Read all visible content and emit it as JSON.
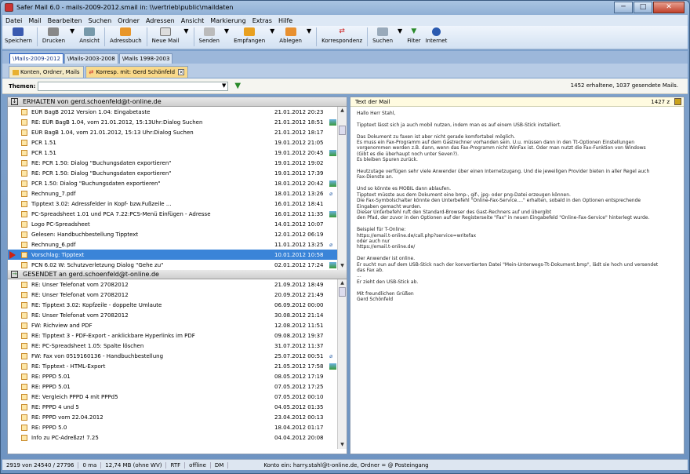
{
  "window": {
    "title": "Safer Mail 6.0 - mails-2009-2012.smail in: \\\\vertrieb\\public\\maildaten",
    "min": "─",
    "max": "□",
    "close": "✕"
  },
  "menu": [
    "Datei",
    "Mail",
    "Bearbeiten",
    "Suchen",
    "Ordner",
    "Adressen",
    "Ansicht",
    "Markierung",
    "Extras",
    "Hilfe"
  ],
  "toolbar": {
    "save": "Speichern",
    "print": "Drucken",
    "view": "Ansicht",
    "address": "Adressbuch",
    "newmail": "Neue Mail",
    "send": "Senden",
    "receive": "Empfangen",
    "file": "Ablegen",
    "corr": "Korrespondenz",
    "search": "Suchen",
    "filter": "Filter",
    "internet": "Internet"
  },
  "tabs": [
    "\\Mails-2009-2012",
    "\\Mails-2003-2008",
    "\\Mails 1998-2003"
  ],
  "subtabs": [
    "Konten, Ordner, Mails",
    "Korresp. mit: Gerd Schönfeld"
  ],
  "filter": {
    "label": "Themen:",
    "stats": "1452 erhaltene, 1037 gesendete Mails."
  },
  "received": {
    "header": "ERHALTEN von gerd.schoenfeld@t-online.de",
    "rows": [
      [
        "EÜR BagB 2012 Version 1.04: Eingabetaste",
        "21.01.2012 20:23",
        ""
      ],
      [
        "RE: EÜR BagB 1.04, vom 21.01.2012, 15:13Uhr:Dialog Suchen",
        "21.01.2012 18:51",
        "img"
      ],
      [
        "EÜR BagB 1.04, vom 21.01.2012, 15:13 Uhr:Dialog Suchen",
        "21.01.2012 18:17",
        ""
      ],
      [
        "PCR 1.51",
        "19.01.2012 21:05",
        ""
      ],
      [
        "PCR 1.51",
        "19.01.2012 20:45",
        "img"
      ],
      [
        "RE: PCR 1.50: Dialog \"Buchungsdaten exportieren\"",
        "19.01.2012 19:02",
        ""
      ],
      [
        "RE: PCR 1.50: Dialog \"Buchungsdaten exportieren\"",
        "19.01.2012 17:39",
        ""
      ],
      [
        "PCR 1.50: Dialog \"Buchungsdaten exportieren\"",
        "18.01.2012 20:42",
        "img"
      ],
      [
        "Rechnung_7.pdf",
        "18.01.2012 13:26",
        "att"
      ],
      [
        "Tipptext 3.02: Adressfelder in Kopf- bzw.Fußzeile ...",
        "16.01.2012 18:41",
        ""
      ],
      [
        "PC-Spreadsheet 1.01 und PCA 7.22:PCS-Menü Einfügen - Adresse",
        "16.01.2012 11:35",
        "img"
      ],
      [
        "Logo PC-Spreadsheet",
        "14.01.2012 10:07",
        ""
      ],
      [
        "Gelesen: Handbuchbestellung Tipptext",
        "12.01.2012 06:19",
        ""
      ],
      [
        "Rechnung_6.pdf",
        "11.01.2012 13:25",
        "att"
      ],
      [
        "Vorschlag: Tipptext",
        "10.01.2012 10:58",
        "sel"
      ],
      [
        "PCN 6.02 W: Schutzverletzung Dialog \"Gehe zu\"",
        "02.01.2012 17:24",
        "img"
      ]
    ]
  },
  "sent": {
    "header": "GESENDET an gerd.schoenfeld@t-online.de",
    "rows": [
      [
        "RE: Unser Telefonat vom 27082012",
        "21.09.2012 18:49",
        ""
      ],
      [
        "RE: Unser Telefonat vom 27082012",
        "20.09.2012 21:49",
        ""
      ],
      [
        "RE: Tipptext 3.02: Kopfzeile - doppelte Umlaute",
        "06.09.2012 00:00",
        ""
      ],
      [
        "RE: Unser Telefonat vom 27082012",
        "30.08.2012 21:14",
        ""
      ],
      [
        "FW: Richview and PDF",
        "12.08.2012 11:51",
        ""
      ],
      [
        "RE: Tipptext 3 - PDF-Export - anklickbare Hyperlinks im PDF",
        "09.08.2012 19:37",
        ""
      ],
      [
        "RE: PC-Spreadsheet 1.05: Spalte löschen",
        "31.07.2012 11:37",
        ""
      ],
      [
        "FW: Fax von 0519160136 - Handbuchbestellung",
        "25.07.2012 00:51",
        "att"
      ],
      [
        "RE: Tipptext - HTML-Export",
        "21.05.2012 17:58",
        "img"
      ],
      [
        "RE: PPPD 5.01",
        "08.05.2012 17:19",
        ""
      ],
      [
        "RE: PPPD 5.01",
        "07.05.2012 17:25",
        ""
      ],
      [
        "RE: Vergleich PPPD 4 mit PPPd5",
        "07.05.2012 00:10",
        ""
      ],
      [
        "RE: PPPD 4 und 5",
        "04.05.2012 01:35",
        ""
      ],
      [
        "RE: PPPD vom 22.04.2012",
        "23.04.2012 00:13",
        ""
      ],
      [
        "RE: PPPD 5.0",
        "18.04.2012 01:17",
        ""
      ],
      [
        "Info zu PC-Adreßzz! 7.25",
        "04.04.2012 20:08",
        ""
      ]
    ]
  },
  "mailtext": {
    "header": "Text der Mail",
    "count": "1427 z",
    "body": "Hallo Herr Stahl,\n\nTipptext lässt sich ja auch mobil nutzen, indem man es auf einem USB-Stick installiert.\n\nDas Dokument zu faxen ist aber nicht gerade komfortabel möglich.\nEs muss ein Fax-Programm auf dem Gastrechner vorhanden sein. U.u. müssen dann in den Tt-Optionen Einstellungen\nvorgenommen werden z.B. dann, wenn das Fax-Programm nicht WinFax ist. Oder man nutzt die Fax-Funktion von Windows\n(Gibt es die überhaupt noch unter Seven?).\nEs bleiben Spuren zurück.\n\nHeutzutage verfügen sehr viele Anwender über einen Internetzugang. Und die jeweiligen Provider bieten in aller Regel auch\nFax-Dienste an.\n\nUnd so könnte es MOBIL dann ablaufen.\nTipptext müsste aus dem Dokument eine bmp-, gif-, jpg- oder png-Datei erzeugen können.\nDie Fax-Symbolschalter könnte den Unterbefehl \"Online-Fax-Service....\" erhalten, sobald in den Optionen entsprechende\nEingaben gemacht wurden.\nDieser Unterbefehl ruft den Standard-Browser des Gast-Rechners auf und übergibt\nden Pfad, der zuvor in den Optionen auf der Registerseite \"Fax\" in neuen Eingabefeld \"Online-Fax-Service\" hinterlegt wurde.\n\nBeispiel für T-Online:\nhttps://email.t-online.de/call.php?service=writefax\noder auch nur\nhttps://email.t-online.de/\n\nDer Anwender ist online.\nEr sucht nun auf dem USB-Stick nach der konvertierten Datei \"Mein-Unterwegs-Tt-Dokument.bmp\", lädt sie hoch und versendet\ndas Fax ab.\n...\nEr zieht den USB-Stick ab.\n\nMit freundlichen Grüßen\nGerd Schönfeld"
  },
  "status": [
    "2919 von 24540 / 27796",
    "0 ma",
    "12,74 MB  (ohne WV)",
    "RTF",
    "offline",
    "DM",
    "Konto ein: harry.stahl@t-online.de, Ordner = @ Posteingang"
  ]
}
